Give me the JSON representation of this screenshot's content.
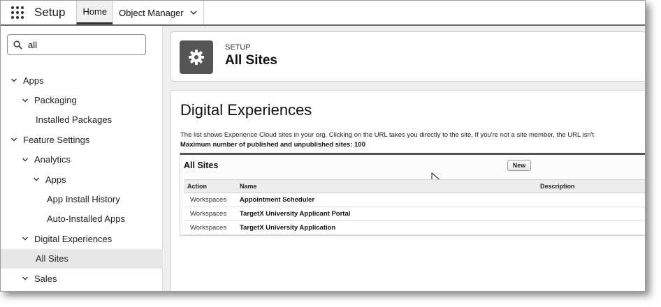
{
  "topbar": {
    "app_name": "Setup",
    "tabs": [
      {
        "label": "Home"
      },
      {
        "label": "Object Manager"
      }
    ]
  },
  "sidebar": {
    "search": {
      "value": "all"
    },
    "tree": [
      {
        "label": "Apps",
        "level": 0,
        "expanded": true
      },
      {
        "label": "Packaging",
        "level": 1,
        "expanded": true
      },
      {
        "label": "Installed Packages",
        "level": 2,
        "leaf": true
      },
      {
        "label": "Feature Settings",
        "level": 0,
        "expanded": true
      },
      {
        "label": "Analytics",
        "level": 1,
        "expanded": true
      },
      {
        "label": "Apps",
        "level": 2,
        "expanded": true
      },
      {
        "label": "App Install History",
        "level": 3,
        "leaf": true
      },
      {
        "label": "Auto-Installed Apps",
        "level": 3,
        "leaf": true
      },
      {
        "label": "Digital Experiences",
        "level": 1,
        "expanded": true
      },
      {
        "label": "All Sites",
        "level": 2,
        "leaf": true,
        "selected": true
      },
      {
        "label": "Sales",
        "level": 1,
        "expanded": true
      }
    ]
  },
  "header": {
    "eyebrow": "SETUP",
    "title": "All Sites"
  },
  "content": {
    "heading": "Digital Experiences",
    "description": "The list shows Experience Cloud sites in your org. Clicking on the URL takes you directly to the site. If you're not a site member, the URL isn't",
    "max_sites": "Maximum number of published and unpublished sites: 100",
    "list": {
      "title": "All Sites",
      "new_label": "New",
      "columns": [
        "Action",
        "Name",
        "Description"
      ],
      "rows": [
        {
          "action": "Workspaces",
          "name": "Appointment Scheduler",
          "description": ""
        },
        {
          "action": "Workspaces",
          "name": "TargetX University Applicant Portal",
          "description": ""
        },
        {
          "action": "Workspaces",
          "name": "TargetX University Application",
          "description": ""
        }
      ]
    }
  },
  "colors": {
    "header_icon_bg": "#555555",
    "selected_bg": "#e8e8e8"
  }
}
